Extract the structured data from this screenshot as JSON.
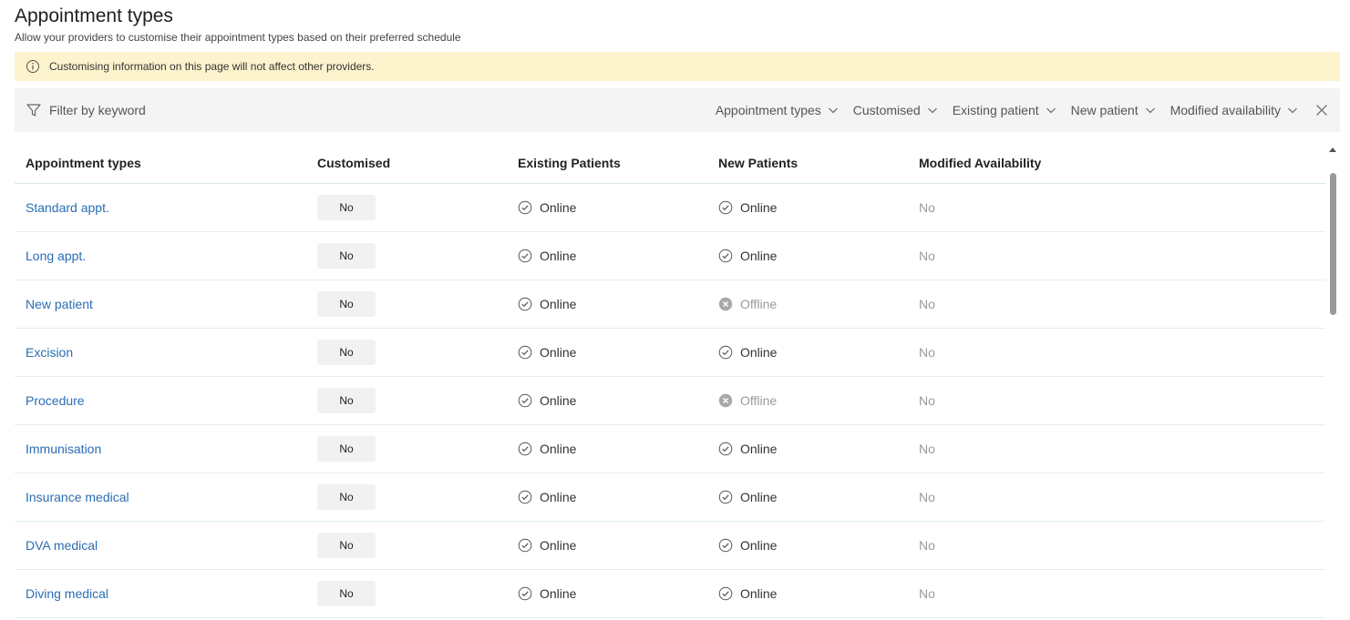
{
  "header": {
    "title": "Appointment types",
    "subtitle": "Allow your providers to customise their appointment types based on their preferred schedule"
  },
  "banner": {
    "text": "Customising information on this page will not affect other providers."
  },
  "filterbar": {
    "placeholder": "Filter by keyword",
    "dropdowns": [
      "Appointment types",
      "Customised",
      "Existing patient",
      "New patient",
      "Modified availability"
    ]
  },
  "table": {
    "columns": [
      "Appointment types",
      "Customised",
      "Existing Patients",
      "New Patients",
      "Modified Availability"
    ],
    "rows": [
      {
        "name": "Standard appt.",
        "customised": "No",
        "existing": "Online",
        "new": "Online",
        "modified": "No"
      },
      {
        "name": "Long appt.",
        "customised": "No",
        "existing": "Online",
        "new": "Online",
        "modified": "No"
      },
      {
        "name": "New patient",
        "customised": "No",
        "existing": "Online",
        "new": "Offline",
        "modified": "No"
      },
      {
        "name": "Excision",
        "customised": "No",
        "existing": "Online",
        "new": "Online",
        "modified": "No"
      },
      {
        "name": "Procedure",
        "customised": "No",
        "existing": "Online",
        "new": "Offline",
        "modified": "No"
      },
      {
        "name": "Immunisation",
        "customised": "No",
        "existing": "Online",
        "new": "Online",
        "modified": "No"
      },
      {
        "name": "Insurance medical",
        "customised": "No",
        "existing": "Online",
        "new": "Online",
        "modified": "No"
      },
      {
        "name": "DVA medical",
        "customised": "No",
        "existing": "Online",
        "new": "Online",
        "modified": "No"
      },
      {
        "name": "Diving medical",
        "customised": "No",
        "existing": "Online",
        "new": "Online",
        "modified": "No"
      }
    ]
  },
  "colors": {
    "link": "#2a6db3",
    "banner": "#fdf3cd",
    "filterbar": "#f4f4f4",
    "offline": "#9a9a9a"
  },
  "icons": {
    "banner": "info-icon",
    "filter": "funnel-icon",
    "dropdown": "chevron-down-icon",
    "clear": "close-icon",
    "online": "check-circle-icon",
    "offline": "x-circle-icon"
  }
}
